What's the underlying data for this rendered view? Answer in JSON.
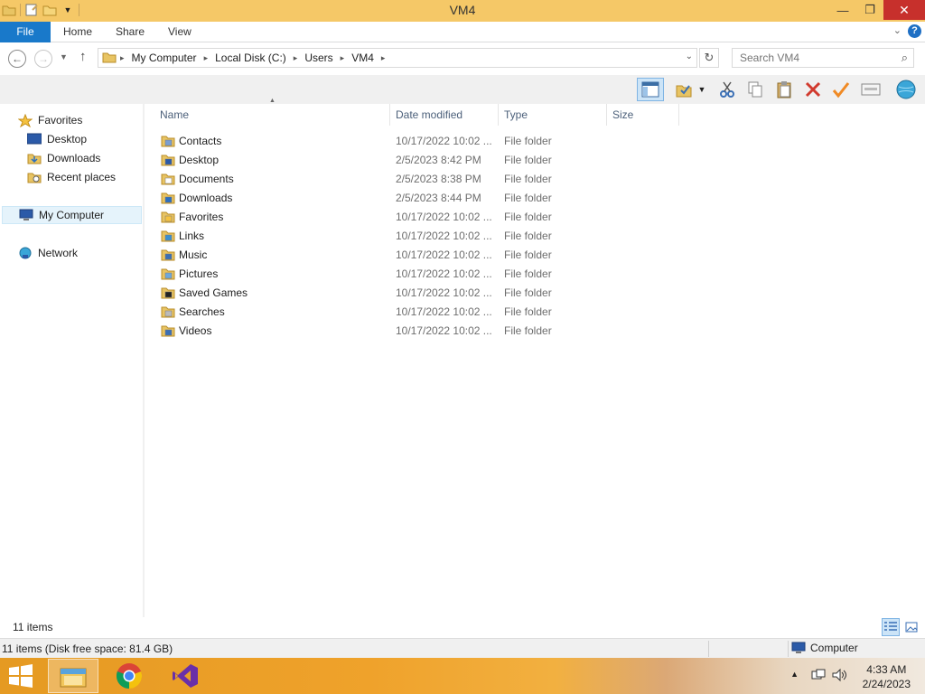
{
  "window": {
    "title": "VM4",
    "controls": {
      "minimize": "—",
      "maximize": "❐",
      "close": "✕"
    }
  },
  "ribbon": {
    "tabs": [
      "File",
      "Home",
      "Share",
      "View"
    ],
    "expand_icon": "chevron-down-icon",
    "help_label": "?"
  },
  "address": {
    "crumbs": [
      "My Computer",
      "Local Disk (C:)",
      "Users",
      "VM4"
    ],
    "search_placeholder": "Search VM4"
  },
  "nav_pane": {
    "favorites_label": "Favorites",
    "favorites": [
      "Desktop",
      "Downloads",
      "Recent places"
    ],
    "computer_label": "My Computer",
    "network_label": "Network"
  },
  "columns": [
    "Name",
    "Date modified",
    "Type",
    "Size"
  ],
  "files": [
    {
      "name": "Contacts",
      "date": "10/17/2022 10:02 ...",
      "type": "File folder",
      "icon": "contacts-folder-icon"
    },
    {
      "name": "Desktop",
      "date": "2/5/2023 8:42 PM",
      "type": "File folder",
      "icon": "desktop-folder-icon"
    },
    {
      "name": "Documents",
      "date": "2/5/2023 8:38 PM",
      "type": "File folder",
      "icon": "documents-folder-icon"
    },
    {
      "name": "Downloads",
      "date": "2/5/2023 8:44 PM",
      "type": "File folder",
      "icon": "downloads-folder-icon"
    },
    {
      "name": "Favorites",
      "date": "10/17/2022 10:02 ...",
      "type": "File folder",
      "icon": "favorites-folder-icon"
    },
    {
      "name": "Links",
      "date": "10/17/2022 10:02 ...",
      "type": "File folder",
      "icon": "links-folder-icon"
    },
    {
      "name": "Music",
      "date": "10/17/2022 10:02 ...",
      "type": "File folder",
      "icon": "music-folder-icon"
    },
    {
      "name": "Pictures",
      "date": "10/17/2022 10:02 ...",
      "type": "File folder",
      "icon": "pictures-folder-icon"
    },
    {
      "name": "Saved Games",
      "date": "10/17/2022 10:02 ...",
      "type": "File folder",
      "icon": "saved-games-folder-icon"
    },
    {
      "name": "Searches",
      "date": "10/17/2022 10:02 ...",
      "type": "File folder",
      "icon": "searches-folder-icon"
    },
    {
      "name": "Videos",
      "date": "10/17/2022 10:02 ...",
      "type": "File folder",
      "icon": "videos-folder-icon"
    }
  ],
  "status": {
    "item_count": "11 items",
    "details": "11 items (Disk free space: 81.4 GB)",
    "location": "Computer"
  },
  "taskbar": {
    "time": "4:33 AM",
    "date": "2/24/2023",
    "apps": [
      "file-explorer-icon",
      "chrome-icon",
      "visual-studio-icon"
    ]
  },
  "colors": {
    "title_bar": "#f5c867",
    "file_tab": "#1979ca",
    "close_button": "#c7302c",
    "folder_yellow": "#e8c463"
  }
}
